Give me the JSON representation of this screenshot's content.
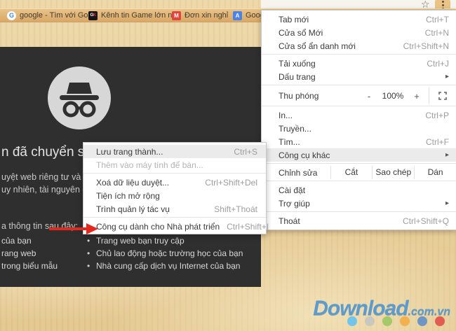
{
  "icons": {
    "star": "☆",
    "submenu_arrow": "▸",
    "bullet": "•"
  },
  "browser": {
    "bookmarks": [
      {
        "label": "google - Tìm với Goo",
        "icon": "google-favicon",
        "glyph": "G"
      },
      {
        "label": "Kênh tin Game lớn nh",
        "icon": "gk-favicon",
        "glyph_g": "G",
        "glyph_k": "K"
      },
      {
        "label": "Đơn xin nghỉ",
        "icon": "gmail-favicon",
        "glyph": "M"
      },
      {
        "label": "Googl",
        "icon": "translate-favicon",
        "glyph": "A"
      }
    ]
  },
  "incognito_page": {
    "heading_fragment": "n đã chuyển sa",
    "body_line1": "uyệt web riêng tư và ng",
    "body_line2": "uy nhiên, tài nguyên đã",
    "body_line3": "a thông tin sau đây:",
    "list_left": [
      "của bạn",
      "rang web",
      "trong biểu mẫu"
    ],
    "list_right": [
      "Trang web bạn truy cập",
      "Chủ lao động hoặc trường học của bạn",
      "Nhà cung cấp dịch vụ Internet của bạn"
    ]
  },
  "main_menu": {
    "new_tab": {
      "label": "Tab mới",
      "shortcut": "Ctrl+T"
    },
    "new_window": {
      "label": "Cửa sổ Mới",
      "shortcut": "Ctrl+N"
    },
    "new_incognito": {
      "label": "Cửa sổ ẩn danh mới",
      "shortcut": "Ctrl+Shift+N"
    },
    "downloads": {
      "label": "Tải xuống",
      "shortcut": "Ctrl+J"
    },
    "bookmarks": {
      "label": "Dấu trang"
    },
    "zoom": {
      "label": "Thu phóng",
      "minus": "-",
      "value": "100%",
      "plus": "+"
    },
    "print": {
      "label": "In...",
      "shortcut": "Ctrl+P"
    },
    "cast": {
      "label": "Truyền..."
    },
    "find": {
      "label": "Tìm...",
      "shortcut": "Ctrl+F"
    },
    "more_tools": {
      "label": "Công cụ khác"
    },
    "edit": {
      "label": "Chỉnh sửa",
      "cut": "Cắt",
      "copy": "Sao chép",
      "paste": "Dán"
    },
    "settings": {
      "label": "Cài đặt"
    },
    "help": {
      "label": "Trợ giúp"
    },
    "exit": {
      "label": "Thoát",
      "shortcut": "Ctrl+Shift+Q"
    }
  },
  "more_tools_menu": {
    "save_page": {
      "label": "Lưu trang thành...",
      "shortcut": "Ctrl+S"
    },
    "add_to_desktop": {
      "label": "Thêm vào máy tính để bàn..."
    },
    "clear_browsing_data": {
      "label": "Xoá dữ liệu duyệt...",
      "shortcut": "Ctrl+Shift+Del"
    },
    "extensions": {
      "label": "Tiện ích mở rộng"
    },
    "task_manager": {
      "label": "Trình quản lý tác vụ",
      "shortcut": "Shift+Thoát"
    },
    "developer_tools": {
      "label": "Công cụ dành cho Nhà phát triển",
      "shortcut": "Ctrl+Shift+I"
    }
  },
  "annotation": {
    "arrow_color": "#e4281e"
  },
  "watermark": {
    "brand": "Download",
    "suffix": ".com.vn",
    "brand_color": "#5b9bce",
    "dot_colors": [
      "#72c5e8",
      "#c8c7c0",
      "#a3c968",
      "#f2b14e",
      "#6e96c3",
      "#e25c50"
    ]
  }
}
